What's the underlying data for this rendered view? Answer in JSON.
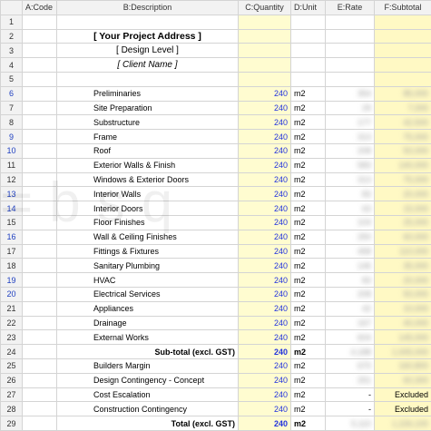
{
  "columns": [
    "",
    "A:Code",
    "B:Description",
    "C:Quantity",
    "D:Unit",
    "E:Rate",
    "F:Subtotal"
  ],
  "watermark": "=bsq",
  "rows": [
    {
      "num": "1",
      "desc": "",
      "qty": "",
      "unit": "",
      "rate": "",
      "sub": "",
      "kind": "blank"
    },
    {
      "num": "2",
      "desc": "[ Your Project Address ]",
      "qty": "",
      "unit": "",
      "rate": "",
      "sub": "",
      "kind": "title"
    },
    {
      "num": "3",
      "desc": "[ Design Level ]",
      "qty": "",
      "unit": "",
      "rate": "",
      "sub": "",
      "kind": "design"
    },
    {
      "num": "4",
      "desc": "[ Client Name ]",
      "qty": "",
      "unit": "",
      "rate": "",
      "sub": "",
      "kind": "client"
    },
    {
      "num": "5",
      "desc": "",
      "qty": "",
      "unit": "",
      "rate": "",
      "sub": "",
      "kind": "blank"
    },
    {
      "num": "6",
      "desc": "Preliminaries",
      "qty": "240",
      "unit": "m2",
      "rate": "354",
      "sub": "85,000",
      "kind": "item"
    },
    {
      "num": "7",
      "desc": "Site Preparation",
      "qty": "240",
      "unit": "m2",
      "rate": "29",
      "sub": "7,000",
      "kind": "item"
    },
    {
      "num": "8",
      "desc": "Substructure",
      "qty": "240",
      "unit": "m2",
      "rate": "177",
      "sub": "42,500",
      "kind": "item"
    },
    {
      "num": "9",
      "desc": "Frame",
      "qty": "240",
      "unit": "m2",
      "rate": "313",
      "sub": "75,000",
      "kind": "item"
    },
    {
      "num": "10",
      "desc": "Roof",
      "qty": "240",
      "unit": "m2",
      "rate": "208",
      "sub": "50,000",
      "kind": "item"
    },
    {
      "num": "11",
      "desc": "Exterior Walls & Finish",
      "qty": "240",
      "unit": "m2",
      "rate": "583",
      "sub": "140,000",
      "kind": "item"
    },
    {
      "num": "12",
      "desc": "Windows & Exterior Doors",
      "qty": "240",
      "unit": "m2",
      "rate": "313",
      "sub": "75,000",
      "kind": "item"
    },
    {
      "num": "13",
      "desc": "Interior Walls",
      "qty": "240",
      "unit": "m2",
      "rate": "83",
      "sub": "20,000",
      "kind": "item"
    },
    {
      "num": "14",
      "desc": "Interior Doors",
      "qty": "240",
      "unit": "m2",
      "rate": "63",
      "sub": "15,000",
      "kind": "item"
    },
    {
      "num": "15",
      "desc": "Floor Finishes",
      "qty": "240",
      "unit": "m2",
      "rate": "104",
      "sub": "25,000",
      "kind": "item"
    },
    {
      "num": "16",
      "desc": "Wall & Ceiling Finishes",
      "qty": "240",
      "unit": "m2",
      "rate": "250",
      "sub": "60,000",
      "kind": "item"
    },
    {
      "num": "17",
      "desc": "Fittings & Fixtures",
      "qty": "240",
      "unit": "m2",
      "rate": "458",
      "sub": "110,000",
      "kind": "item"
    },
    {
      "num": "18",
      "desc": "Sanitary Plumbing",
      "qty": "240",
      "unit": "m2",
      "rate": "146",
      "sub": "35,000",
      "kind": "item"
    },
    {
      "num": "19",
      "desc": "HVAC",
      "qty": "240",
      "unit": "m2",
      "rate": "83",
      "sub": "20,000",
      "kind": "item"
    },
    {
      "num": "20",
      "desc": "Electrical Services",
      "qty": "240",
      "unit": "m2",
      "rate": "208",
      "sub": "50,000",
      "kind": "item"
    },
    {
      "num": "21",
      "desc": "Appliances",
      "qty": "240",
      "unit": "m2",
      "rate": "42",
      "sub": "10,000",
      "kind": "item"
    },
    {
      "num": "22",
      "desc": "Drainage",
      "qty": "240",
      "unit": "m2",
      "rate": "167",
      "sub": "40,000",
      "kind": "item"
    },
    {
      "num": "23",
      "desc": "External Works",
      "qty": "240",
      "unit": "m2",
      "rate": "604",
      "sub": "145,000",
      "kind": "item"
    },
    {
      "num": "24",
      "desc": "Sub-total (excl. GST)",
      "qty": "240",
      "unit": "m2",
      "rate": "4,188",
      "sub": "1,005,000",
      "kind": "subtotal"
    },
    {
      "num": "25",
      "desc": "Builders Margin",
      "qty": "240",
      "unit": "m2",
      "rate": "670",
      "sub": "160,800",
      "kind": "item"
    },
    {
      "num": "26",
      "desc": "Design Contingency - Concept",
      "qty": "240",
      "unit": "m2",
      "rate": "251",
      "sub": "60,300",
      "kind": "item"
    },
    {
      "num": "27",
      "desc": "Cost Escalation",
      "qty": "240",
      "unit": "m2",
      "rate": "-",
      "sub": "Excluded",
      "kind": "excl"
    },
    {
      "num": "28",
      "desc": "Construction Contingency",
      "qty": "240",
      "unit": "m2",
      "rate": "-",
      "sub": "Excluded",
      "kind": "excl"
    },
    {
      "num": "29",
      "desc": "Total (excl. GST)",
      "qty": "240",
      "unit": "m2",
      "rate": "5,110",
      "sub": "1,226,100",
      "kind": "total"
    }
  ]
}
